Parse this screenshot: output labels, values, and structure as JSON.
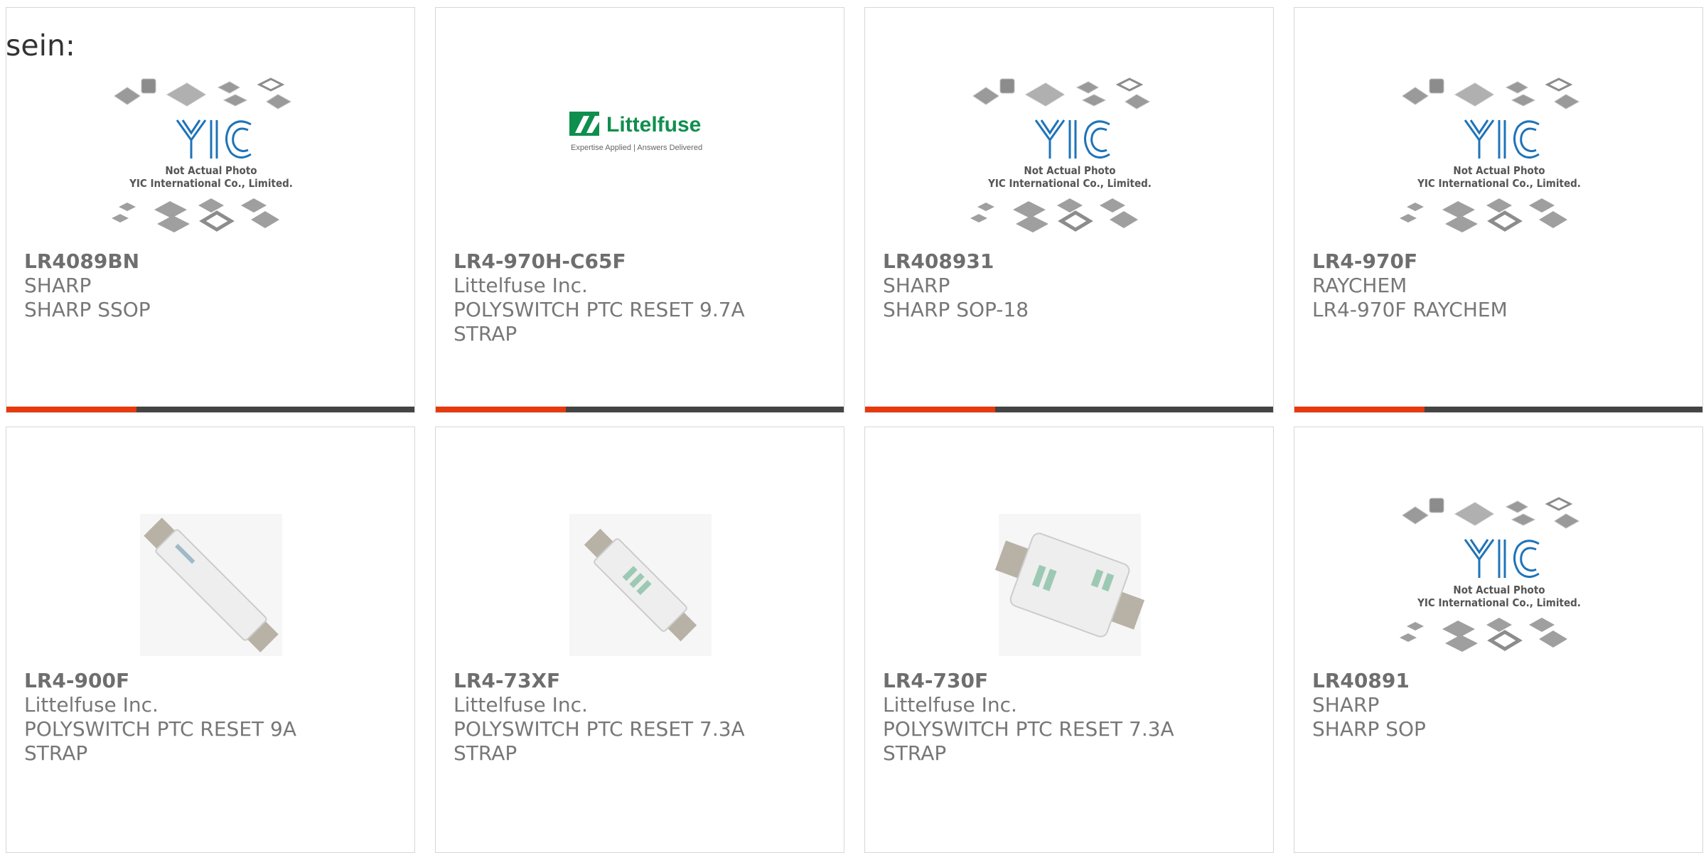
{
  "page": {
    "lead_text": "sein:"
  },
  "colors": {
    "accent_red": "#e8380d",
    "accent_dark": "#444444",
    "card_border": "#d7d7d7",
    "text_grey": "#777777",
    "part_number_grey": "#6e6e6e",
    "littelfuse_green": "#0f8f4d"
  },
  "products": [
    {
      "part_number": "LR4089BN",
      "manufacturer": "SHARP",
      "description": "SHARP SSOP",
      "image": "yic-placeholder-logo",
      "image_text": [
        "Not Actual Photo",
        "YIC International Co., Limited."
      ]
    },
    {
      "part_number": "LR4-970H-C65F",
      "manufacturer": "Littelfuse Inc.",
      "description": "POLYSWITCH PTC RESET 9.7A STRAP",
      "image": "littelfuse-logo",
      "image_text": [
        "Littelfuse",
        "Expertise Applied | Answers Delivered"
      ]
    },
    {
      "part_number": "LR408931",
      "manufacturer": "SHARP",
      "description": "SHARP SOP-18",
      "image": "yic-placeholder-logo",
      "image_text": [
        "Not Actual Photo",
        "YIC International Co., Limited."
      ]
    },
    {
      "part_number": "LR4-970F",
      "manufacturer": "RAYCHEM",
      "description": "LR4-970F RAYCHEM",
      "image": "yic-placeholder-logo",
      "image_text": [
        "Not Actual Photo",
        "YIC International Co., Limited."
      ]
    },
    {
      "part_number": "LR4-900F",
      "manufacturer": "Littelfuse Inc.",
      "description": "POLYSWITCH PTC RESET 9A STRAP",
      "image": "polyswitch-strap-long-photo",
      "image_text": []
    },
    {
      "part_number": "LR4-73XF",
      "manufacturer": "Littelfuse Inc.",
      "description": "POLYSWITCH PTC RESET 7.3A STRAP",
      "image": "polyswitch-strap-short-photo",
      "image_text": []
    },
    {
      "part_number": "LR4-730F",
      "manufacturer": "Littelfuse Inc.",
      "description": "POLYSWITCH PTC RESET 7.3A STRAP",
      "image": "polyswitch-strap-wide-photo",
      "image_text": []
    },
    {
      "part_number": "LR40891",
      "manufacturer": "SHARP",
      "description": "SHARP SOP",
      "image": "yic-placeholder-logo",
      "image_text": [
        "Not Actual Photo",
        "YIC International Co., Limited."
      ]
    }
  ]
}
